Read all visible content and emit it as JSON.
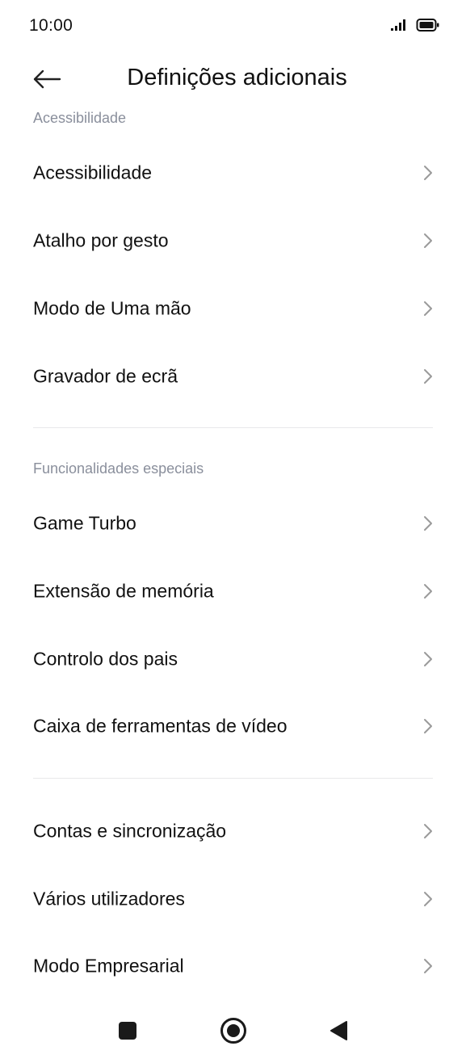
{
  "status_bar": {
    "time": "10:00",
    "icons": [
      "signal-icon",
      "battery-icon"
    ]
  },
  "header": {
    "back_icon": "arrow-left-icon",
    "title": "Definições adicionais"
  },
  "sections": [
    {
      "label": "Acessibilidade",
      "items": [
        {
          "label": "Acessibilidade"
        },
        {
          "label": "Atalho por gesto"
        },
        {
          "label": "Modo de Uma mão"
        },
        {
          "label": "Gravador de ecrã"
        }
      ]
    },
    {
      "label": "Funcionalidades especiais",
      "items": [
        {
          "label": "Game Turbo"
        },
        {
          "label": "Extensão de memória"
        },
        {
          "label": "Controlo dos pais"
        },
        {
          "label": "Caixa de ferramentas de vídeo"
        }
      ]
    },
    {
      "label": "",
      "items": [
        {
          "label": "Contas e sincronização"
        },
        {
          "label": "Vários utilizadores"
        },
        {
          "label": "Modo Empresarial"
        }
      ]
    }
  ],
  "nav_bar": {
    "icons": [
      "recents-square-icon",
      "home-circle-icon",
      "back-triangle-icon"
    ]
  },
  "colors": {
    "text": "#111111",
    "section_label": "#8a8f9c",
    "divider": "#e8e8ea",
    "chevron": "#9a9a9a",
    "nav_icons": "#1a1a1a"
  }
}
